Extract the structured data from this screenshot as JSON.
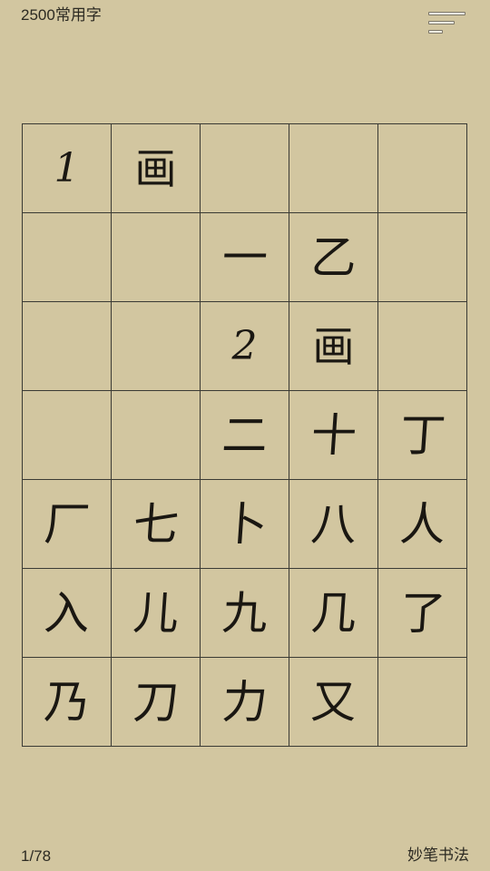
{
  "header": {
    "title": "2500常用字",
    "menu_icon": "menu-lines-icon"
  },
  "grid": {
    "rows": [
      [
        {
          "type": "stroke-count",
          "text": "1"
        },
        {
          "type": "stroke-label",
          "text": "画"
        },
        {
          "type": "empty",
          "text": ""
        },
        {
          "type": "empty",
          "text": ""
        },
        {
          "type": "empty",
          "text": ""
        }
      ],
      [
        {
          "type": "empty",
          "text": ""
        },
        {
          "type": "empty",
          "text": ""
        },
        {
          "type": "char",
          "text": "一"
        },
        {
          "type": "char",
          "text": "乙"
        },
        {
          "type": "empty",
          "text": ""
        }
      ],
      [
        {
          "type": "empty",
          "text": ""
        },
        {
          "type": "empty",
          "text": ""
        },
        {
          "type": "stroke-count",
          "text": "2"
        },
        {
          "type": "stroke-label",
          "text": "画"
        },
        {
          "type": "empty",
          "text": ""
        }
      ],
      [
        {
          "type": "empty",
          "text": ""
        },
        {
          "type": "empty",
          "text": ""
        },
        {
          "type": "char",
          "text": "二"
        },
        {
          "type": "char",
          "text": "十"
        },
        {
          "type": "char",
          "text": "丁"
        }
      ],
      [
        {
          "type": "char",
          "text": "厂"
        },
        {
          "type": "char",
          "text": "七"
        },
        {
          "type": "char",
          "text": "卜"
        },
        {
          "type": "char",
          "text": "八"
        },
        {
          "type": "char",
          "text": "人"
        }
      ],
      [
        {
          "type": "char",
          "text": "入"
        },
        {
          "type": "char",
          "text": "儿"
        },
        {
          "type": "char",
          "text": "九"
        },
        {
          "type": "char",
          "text": "几"
        },
        {
          "type": "char",
          "text": "了"
        }
      ],
      [
        {
          "type": "char",
          "text": "乃"
        },
        {
          "type": "char",
          "text": "刀"
        },
        {
          "type": "char",
          "text": "力"
        },
        {
          "type": "char",
          "text": "又"
        },
        {
          "type": "empty",
          "text": ""
        }
      ]
    ]
  },
  "footer": {
    "page_indicator": "1/78",
    "brand": "妙笔书法"
  }
}
